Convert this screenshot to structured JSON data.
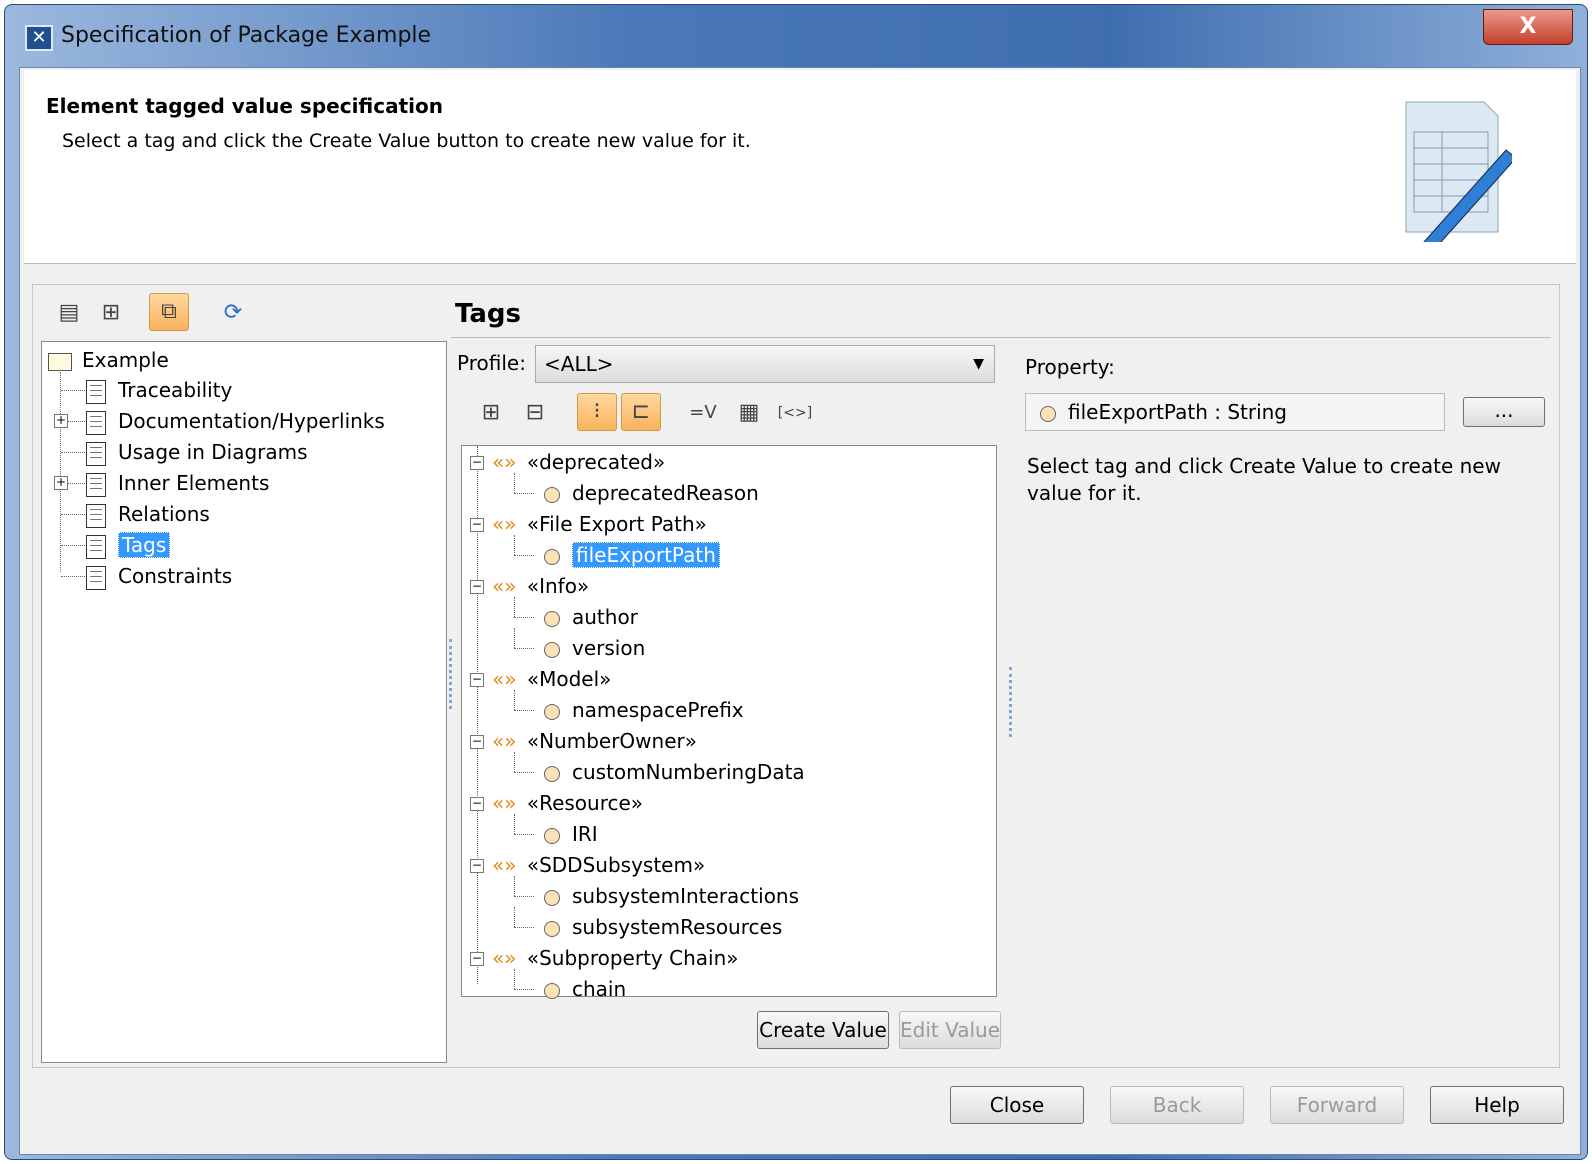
{
  "window": {
    "title": "Specification of Package Example",
    "close": "X"
  },
  "header": {
    "title": "Element tagged value specification",
    "description": "Select a tag and click the Create Value button to create new value for it."
  },
  "left_tree": {
    "root": "Example",
    "items": [
      {
        "label": "Traceability",
        "expandable": false
      },
      {
        "label": "Documentation/Hyperlinks",
        "expandable": true
      },
      {
        "label": "Usage in Diagrams",
        "expandable": false
      },
      {
        "label": "Inner Elements",
        "expandable": true
      },
      {
        "label": "Relations",
        "expandable": false
      },
      {
        "label": "Tags",
        "expandable": false,
        "selected": true
      },
      {
        "label": "Constraints",
        "expandable": false
      }
    ]
  },
  "main": {
    "title": "Tags",
    "profile_label": "Profile:",
    "profile_value": "<ALL>",
    "property_label": "Property:",
    "property_value": "fileExportPath : String",
    "browse": "...",
    "hint": "Select tag and click Create Value to create new value for it.",
    "stereotypes": [
      {
        "name": "«deprecated»",
        "tags": [
          "deprecatedReason"
        ]
      },
      {
        "name": "«File Export Path»",
        "tags": [
          "fileExportPath"
        ]
      },
      {
        "name": "«Info»",
        "tags": [
          "author",
          "version"
        ]
      },
      {
        "name": "«Model»",
        "tags": [
          "namespacePrefix"
        ]
      },
      {
        "name": "«NumberOwner»",
        "tags": [
          "customNumberingData"
        ]
      },
      {
        "name": "«Resource»",
        "tags": [
          "IRI"
        ]
      },
      {
        "name": "«SDDSubsystem»",
        "tags": [
          "subsystemInteractions",
          "subsystemResources"
        ]
      },
      {
        "name": "«Subproperty Chain»",
        "tags": [
          "chain"
        ]
      }
    ],
    "selected_tag": "fileExportPath",
    "create_value": "Create Value",
    "edit_value": "Edit Value"
  },
  "footer": {
    "close": "Close",
    "back": "Back",
    "forward": "Forward",
    "help": "Help"
  }
}
